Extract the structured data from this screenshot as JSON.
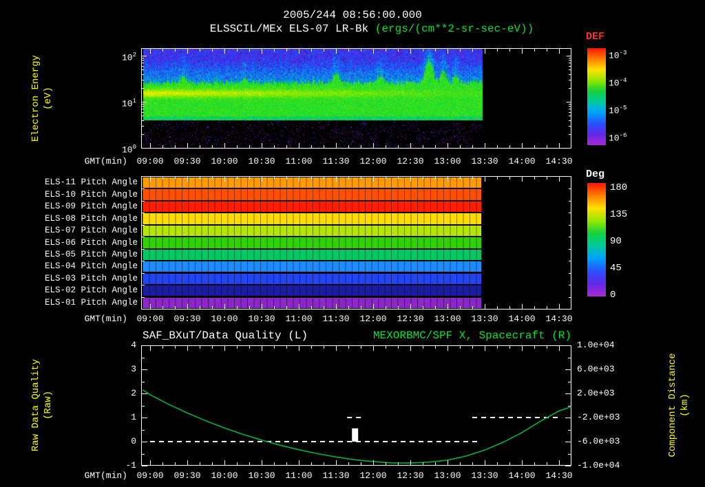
{
  "header": {
    "date_title": "2005/244 08:56:00.000",
    "instrument_title": "ELSSCIL/MEx ELS-07 LR-Bk",
    "units_title": " (ergs/(cm**2-sr-sec-eV))"
  },
  "time_axis": {
    "label": "GMT(min)",
    "tick_labels": [
      "09:00",
      "09:30",
      "10:00",
      "10:30",
      "11:00",
      "11:30",
      "12:00",
      "12:30",
      "13:00",
      "13:30",
      "14:00",
      "14:30"
    ],
    "tick_minutes": [
      540,
      570,
      600,
      630,
      660,
      690,
      720,
      750,
      780,
      810,
      840,
      870
    ],
    "minor_step_min": 10
  },
  "colors": {
    "background": "#000000",
    "axis": "#ffffff",
    "axis_title_yellow": "#ffff00",
    "accent_green": "#00e62e",
    "def_label_red": "#ff3222"
  },
  "chart_data": [
    {
      "type": "heatmap",
      "name": "electron-energy-spectrogram",
      "title": "ELSSCIL/MEx ELS-07 LR-Bk",
      "units": "ergs/(cm**2-sr-sec-eV)",
      "xlabel": "GMT(min)",
      "ylabel_lines": [
        "Electron Energy",
        "(eV)"
      ],
      "y_scale": "log",
      "y_range_eV": [
        1,
        145
      ],
      "y_tick_exponents": [
        2,
        1,
        0
      ],
      "data_time_range": [
        "08:56",
        "13:26"
      ],
      "colorbar": {
        "label": "DEF",
        "label_color": "#ff3222",
        "scale": "log",
        "tick_exponents": [
          -3,
          -4,
          -5,
          -6
        ],
        "gradient_top_to_bottom": [
          "#ff1400",
          "#ff7d00",
          "#ffe100",
          "#96e600",
          "#14d23c",
          "#00c8a0",
          "#00a0ff",
          "#2850ff",
          "#6428e6",
          "#aa28d2"
        ]
      },
      "features": {
        "main_band_eV": [
          5,
          28
        ],
        "main_band_flux": "green ~1e-4",
        "enhanced_line_eV": [
          12,
          20
        ],
        "high_energy_noise_eV": [
          30,
          145
        ],
        "high_energy_flux": "blue ~3e-6",
        "sparse_speckle_eV": [
          1,
          4
        ],
        "plume_times": [
          "11:33",
          "12:08",
          "12:44",
          "13:03"
        ]
      }
    },
    {
      "type": "heatmap",
      "name": "pitch-angle-rows",
      "data_time_range": [
        "09:00",
        "13:26"
      ],
      "colorbar": {
        "label": "Deg",
        "ticks": [
          180,
          135,
          90,
          45,
          0
        ],
        "min": 0,
        "max": 180,
        "gradient_top_to_bottom": [
          "#ff1400",
          "#ff7d00",
          "#ffe100",
          "#96e600",
          "#14d23c",
          "#00c8a0",
          "#00a0ff",
          "#2850ff",
          "#6428e6",
          "#aa28d2"
        ]
      },
      "rows": [
        {
          "label": "ELS-11 Pitch Angle",
          "approx_deg": 155,
          "color": "#ff9b00"
        },
        {
          "label": "ELS-10 Pitch Angle",
          "approx_deg": 166,
          "color": "#ff5000"
        },
        {
          "label": "ELS-09 Pitch Angle",
          "approx_deg": 176,
          "color": "#ff1e00"
        },
        {
          "label": "ELS-08 Pitch Angle",
          "approx_deg": 140,
          "color": "#ffdc00"
        },
        {
          "label": "ELS-07 Pitch Angle",
          "approx_deg": 124,
          "color": "#b4e600"
        },
        {
          "label": "ELS-06 Pitch Angle",
          "approx_deg": 104,
          "color": "#32d200"
        },
        {
          "label": "ELS-05 Pitch Angle",
          "approx_deg": 92,
          "color": "#00c862"
        },
        {
          "label": "ELS-04 Pitch Angle",
          "approx_deg": 64,
          "color": "#1e8cff"
        },
        {
          "label": "ELS-03 Pitch Angle",
          "approx_deg": 46,
          "color": "#2344f0"
        },
        {
          "label": "ELS-02 Pitch Angle",
          "approx_deg": 27,
          "color": "#1c1ca0"
        },
        {
          "label": "ELS-01 Pitch Angle",
          "approx_deg": 9,
          "color": "#8c28c8"
        }
      ]
    },
    {
      "type": "line",
      "name": "data-quality-and-spacecraft-x",
      "title_left": "SAF_BXuT/Data Quality (L)",
      "title_right": "MEXORBMC/SPF X, Spacecraft (R)",
      "left_axis": {
        "label_lines": [
          "Raw Data Quality",
          "(Raw)"
        ],
        "ticks": [
          4,
          3,
          2,
          1,
          0,
          -1
        ],
        "range": [
          -1,
          4
        ]
      },
      "right_axis": {
        "label_lines": [
          "Component Distance",
          "(km)"
        ],
        "tick_labels": [
          "1.0e+04",
          "6.0e+03",
          "2.0e+03",
          "-2.0e+03",
          "-6.0e+03",
          "-1.0e+04"
        ],
        "range": [
          -10000,
          10000
        ]
      },
      "series": [
        {
          "name": "SAF_BXuT/Data Quality",
          "axis": "left",
          "style": "dashed",
          "color": "#ffffff",
          "segments": [
            {
              "value": 0,
              "from": "09:00",
              "to": "13:25"
            },
            {
              "value": 1,
              "from": "11:39",
              "to": "11:51"
            },
            {
              "value": 1,
              "from": "13:20",
              "to": "14:30"
            }
          ],
          "transition_marker": {
            "time": "11:44",
            "value_from": 0,
            "value_to": 0.55
          }
        },
        {
          "name": "MEXORBMC/SPF X, Spacecraft",
          "axis": "right",
          "style": "solid",
          "color": "#00b33c",
          "t_min": [
            534,
            540,
            555,
            570,
            585,
            600,
            615,
            630,
            645,
            660,
            675,
            690,
            705,
            720,
            735,
            750,
            765,
            780,
            795,
            810,
            825,
            840,
            855,
            870,
            880
          ],
          "km": [
            2600,
            1800,
            200,
            -1250,
            -2550,
            -3750,
            -4800,
            -5750,
            -6600,
            -7350,
            -8000,
            -8550,
            -9000,
            -9330,
            -9530,
            -9560,
            -9420,
            -9080,
            -8400,
            -7400,
            -6100,
            -4500,
            -2600,
            -900,
            -200
          ]
        }
      ]
    }
  ]
}
